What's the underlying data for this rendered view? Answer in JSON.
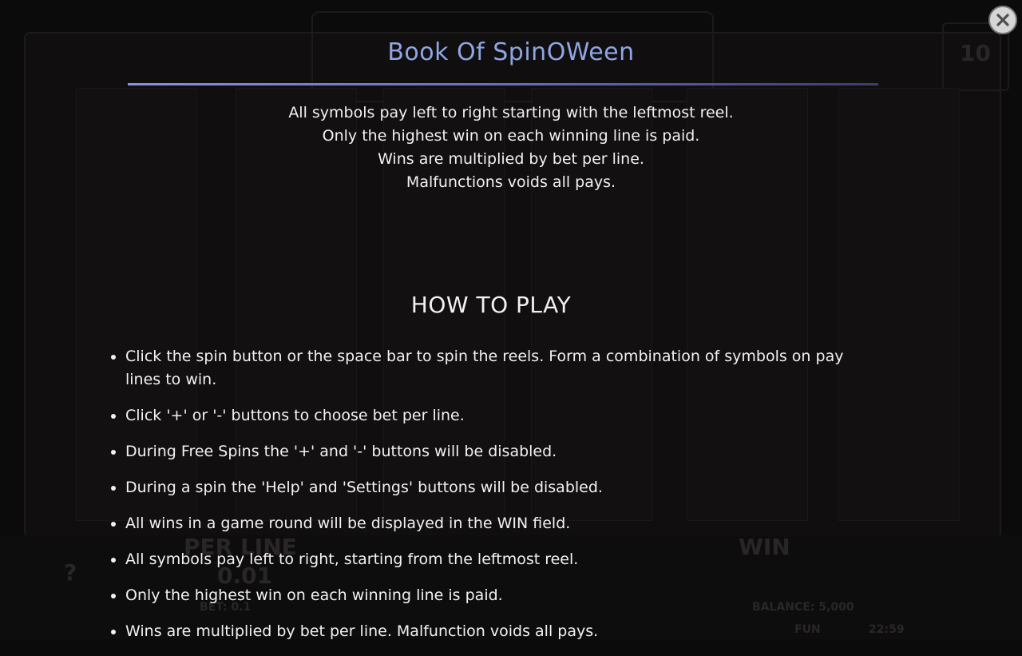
{
  "modal": {
    "title": "Book Of SpinOWeen",
    "close_icon": "close-icon",
    "intro_lines": [
      "All symbols pay left to right starting with the leftmost reel.",
      "Only the highest win on each winning line is paid.",
      "Wins are multiplied by bet per line.",
      "Malfunctions voids all pays."
    ],
    "how_to_play": {
      "heading": "HOW TO PLAY",
      "items": [
        "Click the spin button or the space bar to spin the reels. Form a combination of symbols on pay lines to win.",
        "Click '+' or '-' buttons to choose bet per line.",
        "During Free Spins the '+' and '-' buttons will be disabled.",
        "During a spin the 'Help' and 'Settings' buttons will be disabled.",
        "All wins in a game round will be displayed in the WIN field.",
        "All symbols pay left to right, starting from the leftmost reel.",
        "Only the highest win on each winning line is paid.",
        "Wins are multiplied by bet per line. Malfunction voids all pays."
      ]
    }
  },
  "background_game": {
    "per_line_label": "PER LINE",
    "per_line_value": "0.01",
    "bet_label": "BET: 0.1",
    "win_label": "WIN",
    "balance_label": "BALANCE: 5,000",
    "fun_label": "FUN",
    "clock": "22:59",
    "help_icon": "?",
    "counter": "10"
  },
  "colors": {
    "title": "#8fa6e2",
    "text": "#f2f2f2",
    "overlay_bg": "#0c0b0c"
  }
}
